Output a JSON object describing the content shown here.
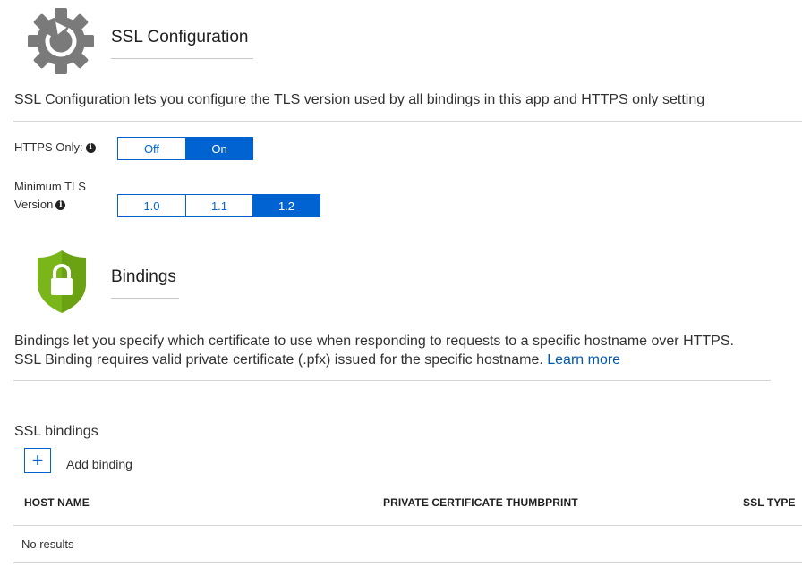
{
  "ssl_section": {
    "title": "SSL Configuration",
    "icon": "gear-icon",
    "description": "SSL Configuration lets you configure the TLS version used by all bindings in this app and HTTPS only setting"
  },
  "https_only": {
    "label": "HTTPS Only:",
    "options": [
      "Off",
      "On"
    ],
    "selected": "On"
  },
  "min_tls": {
    "label_line1": "Minimum TLS",
    "label_line2": "Version",
    "options": [
      "1.0",
      "1.1",
      "1.2"
    ],
    "selected": "1.2"
  },
  "bindings_section": {
    "title": "Bindings",
    "icon": "shield-lock-icon",
    "description_line1": "Bindings let you specify which certificate to use when responding to requests to a specific hostname over HTTPS.",
    "description_line2": "SSL Binding requires valid private certificate (.pfx) issued for the specific hostname.",
    "learn_more": "Learn more"
  },
  "ssl_bindings": {
    "heading": "SSL bindings",
    "add_label": "Add binding",
    "columns": [
      "HOST NAME",
      "PRIVATE CERTIFICATE THUMBPRINT",
      "SSL TYPE"
    ],
    "empty_text": "No results"
  },
  "colors": {
    "accent": "#0063d1",
    "shield_green": "#7ab61a",
    "gear_gray": "#7a7a7a"
  }
}
